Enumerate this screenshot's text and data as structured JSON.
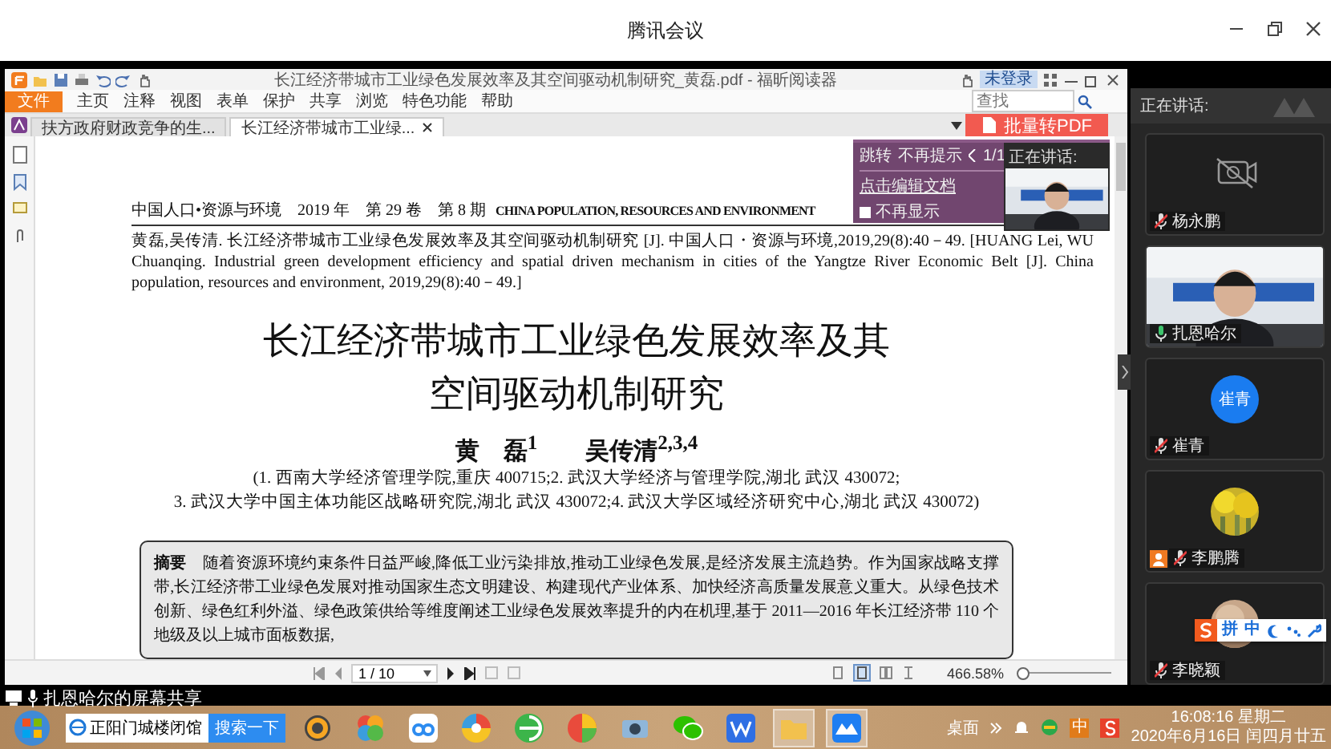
{
  "window": {
    "title": "腾讯会议"
  },
  "reader": {
    "title": "长江经济带城市工业绿色发展效率及其空间驱动机制研究_黄磊.pdf - 福昕阅读器",
    "login_button": "未登录",
    "file_button": "文件",
    "ribbon_tabs": [
      "主页",
      "注释",
      "视图",
      "表单",
      "保护",
      "共享",
      "浏览",
      "特色功能",
      "帮助"
    ],
    "find_field": {
      "placeholder": "查找"
    },
    "doc_tabs": [
      {
        "label": "扶方政府财政竞争的生...",
        "selected": false
      },
      {
        "label": "长江经济带城市工业绿...",
        "selected": true
      }
    ],
    "convert_button": "批量转PDF",
    "page": {
      "header_cn": "中国人口•资源与环境　2019 年　第 29 卷　第 8 期",
      "header_en": "CHINA POPULATION, RESOURCES AND ENVIRONMENT",
      "citation": "黄磊,吴传清. 长江经济带城市工业绿色发展效率及其空间驱动机制研究 [J]. 中国人口・资源与环境,2019,29(8):40－49. [HUANG Lei, WU Chuanqing. Industrial green development efficiency and spatial driven mechanism in cities of the Yangtze River Economic Belt [J]. China population, resources and environment, 2019,29(8):40－49.]",
      "title_lines": [
        "长江经济带城市工业绿色发展效率及其",
        "空间驱动机制研究"
      ],
      "authors": "黄　磊$^{1}$　　吴传清$^{2,3,4}$",
      "affiliations": [
        "(1. 西南大学经济管理学院,重庆 400715;2. 武汉大学经济与管理学院,湖北 武汉 430072;",
        "3. 武汉大学中国主体功能区战略研究院,湖北 武汉 430072;4. 武汉大学区域经济研究中心,湖北 武汉 430072)"
      ],
      "abstract": "**摘要**　随着资源环境约束条件日益严峻,降低工业污染排放,推动工业绿色发展,是经济发展主流趋势。作为国家战略支撑带,长江经济带工业绿色发展对推动国家生态文明建设、构建现代产业体系、加快经济高质量发展意义重大。从绿色技术创新、绿色红利外溢、绿色政策供给等维度阐述工业绿色发展效率提升的内在机理,基于 2011—2016 年长江经济带 110 个地级及以上城市面板数据,"
    },
    "tip_popup": {
      "actions": [
        "跳转",
        "不再提示"
      ],
      "pager": "1/1",
      "link": "点击编辑文档",
      "checkbox": {
        "label": "不再显示",
        "checked": false
      }
    },
    "speaker_overlay": {
      "label": "正在讲话:"
    },
    "status_bar": {
      "page": "1 / 10",
      "zoom": "466.58%",
      "zoom_slider": {
        "level": 0.05
      }
    }
  },
  "share_caption": "扎恩哈尔的屏幕共享",
  "sidebar": {
    "header": "正在讲话:",
    "participants": [
      {
        "name": "杨永鹏",
        "kind": "camera_off",
        "muted": true,
        "host": false
      },
      {
        "name": "扎恩哈尔",
        "kind": "video",
        "muted": false,
        "host": false
      },
      {
        "name": "崔青",
        "kind": "initials",
        "avatar_text": "崔青",
        "muted": true,
        "host": false
      },
      {
        "name": "李鹏腾",
        "muted": true,
        "host": true
      },
      {
        "name": "李晓颖",
        "muted": true,
        "host": false
      }
    ]
  },
  "ime_bar": {
    "items": [
      "拼",
      "中"
    ]
  },
  "taskbar": {
    "search": {
      "value": "正阳门城楼闭馆"
    },
    "search_button": "搜索一下",
    "desktop": "桌面",
    "tray_ime": "中",
    "time": "16:08:16 星期二",
    "date": "2020年6月16日 闰四月廿五"
  }
}
